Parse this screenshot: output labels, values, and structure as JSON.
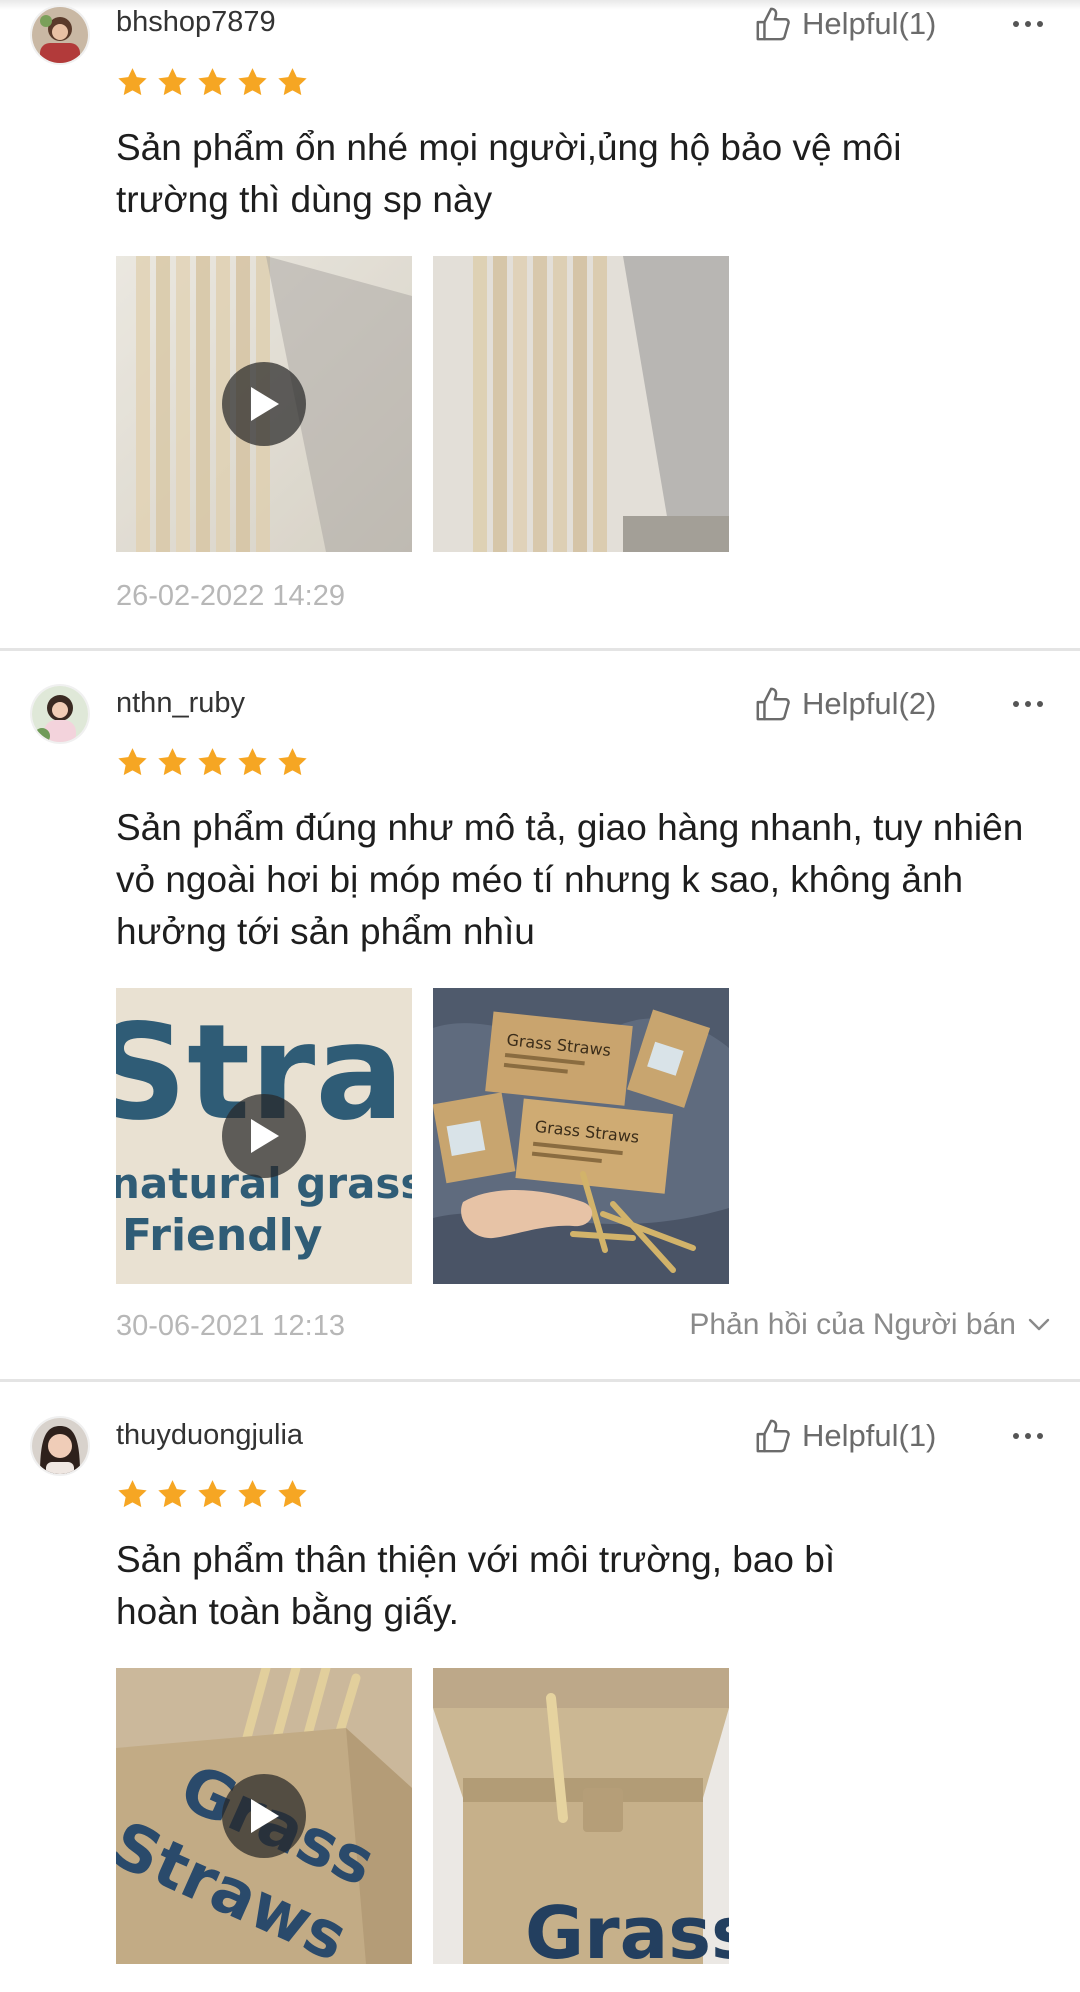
{
  "colors": {
    "star": "#f6a623",
    "date": "#b7b7b7",
    "helpful": "#6b6b6b"
  },
  "icons": {
    "helpful": "thumbs-up-icon",
    "more": "more-dots-icon",
    "star": "star-icon",
    "play": "play-icon",
    "reply_toggle": "chevron-down-icon"
  },
  "reviews": [
    {
      "username": "bhshop7879",
      "helpful_label": "Helpful(1)",
      "rating": 5,
      "text": "Sản phẩm ổn nhé mọi người,ủng hộ bảo vệ môi trường thì dùng sp này",
      "date": "26-02-2022 14:29",
      "media": [
        "video",
        "image"
      ]
    },
    {
      "username": "nthn_ruby",
      "helpful_label": "Helpful(2)",
      "rating": 5,
      "text": "Sản phẩm đúng như mô tả, giao hàng nhanh, tuy nhiên vỏ ngoài hơi bị móp méo tí nhưng k sao, không ảnh hưởng tới sản phẩm nhìu",
      "date": "30-06-2021 12:13",
      "seller_reply_label": "Phản hồi của Người bán",
      "media": [
        "video",
        "image"
      ],
      "media_text": {
        "video_big": "Stra",
        "video_line1": "natural grass",
        "video_line2": "Friendly",
        "box_label": "Grass Straws"
      }
    },
    {
      "username": "thuyduongjulia",
      "helpful_label": "Helpful(1)",
      "rating": 5,
      "text": "Sản phẩm thân thiện với môi trường, bao bì hoàn toàn bằng giấy.",
      "media": [
        "video",
        "image"
      ],
      "media_text": {
        "video_line1": "Grass",
        "video_line2": "Straws",
        "box_label": "Grass"
      }
    }
  ]
}
